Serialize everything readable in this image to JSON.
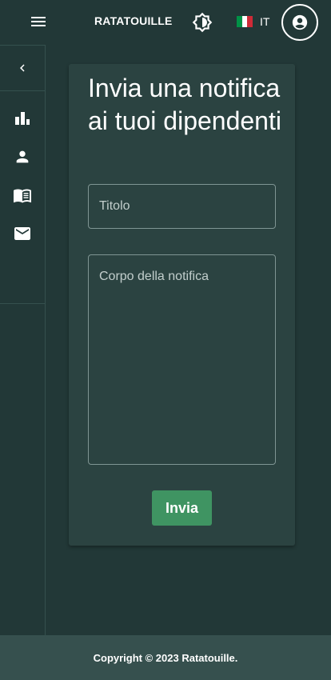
{
  "header": {
    "brand": "RATATOUILLE",
    "language": "IT",
    "icons": {
      "menu": "menu-icon",
      "theme": "brightness-icon",
      "flag": "italy-flag-icon",
      "account": "account-circle-icon"
    }
  },
  "sidebar": {
    "collapse_icon": "chevron-left-icon",
    "items": [
      {
        "icon": "bar-chart-icon"
      },
      {
        "icon": "person-icon"
      },
      {
        "icon": "menu-book-icon"
      },
      {
        "icon": "mail-icon"
      }
    ]
  },
  "form": {
    "title": "Invia una notifica ai tuoi dipendenti",
    "title_placeholder": "Titolo",
    "title_value": "",
    "body_placeholder": "Corpo della notifica",
    "body_value": "",
    "submit_label": "Invia"
  },
  "footer": {
    "copyright": "Copyright © 2023 Ratatouille."
  },
  "colors": {
    "background": "#223837",
    "card": "#2b4341",
    "footer": "#36504e",
    "accent": "#3f9462",
    "text": "#ffffff"
  }
}
